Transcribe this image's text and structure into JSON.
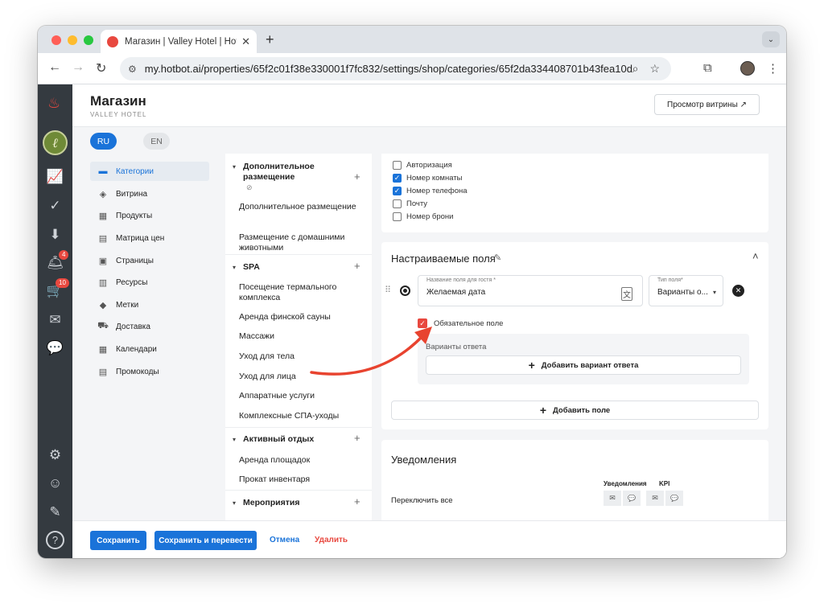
{
  "browser": {
    "tab_title": "Магазин | Valley Hotel | Hotbot",
    "tab_close": "✕",
    "new_tab": "+",
    "tab_menu": "⌄",
    "url": "my.hotbot.ai/properties/65f2c01f38e330001f7fc832/settings/shop/categories/65f2da334408701b43fea10d",
    "icons": {
      "back": "←",
      "forward": "→",
      "reload": "↻",
      "site_info": "⚙",
      "zoom": "⌕",
      "star": "☆",
      "extensions": "⧉",
      "menu": "⋮"
    }
  },
  "rail": {
    "logo": "♨",
    "avatar_initial": "ℓ",
    "icons": [
      "📈",
      "✓",
      "⬇",
      "🛎",
      "🛒",
      "✉",
      "💬"
    ],
    "badge_room_service": "4",
    "badge_cart": "10",
    "bottom_icons": [
      "⚙",
      "☺",
      "✎",
      "?"
    ]
  },
  "header": {
    "title": "Магазин",
    "subtitle": "VALLEY HOTEL",
    "preview_label": "Просмотр витрины ↗"
  },
  "languages": {
    "ru": "RU",
    "en": "EN"
  },
  "sidebar": {
    "items": [
      {
        "label": "Категории",
        "icon": "▬",
        "active": true
      },
      {
        "label": "Витрина",
        "icon": "◈",
        "active": false
      },
      {
        "label": "Продукты",
        "icon": "▦",
        "active": false
      },
      {
        "label": "Матрица цен",
        "icon": "▤",
        "active": false
      },
      {
        "label": "Страницы",
        "icon": "▣",
        "active": false
      },
      {
        "label": "Ресурсы",
        "icon": "▥",
        "active": false
      },
      {
        "label": "Метки",
        "icon": "◆",
        "active": false
      },
      {
        "label": "Доставка",
        "icon": "⛟",
        "active": false
      },
      {
        "label": "Календари",
        "icon": "▦",
        "active": false
      },
      {
        "label": "Промокоды",
        "icon": "▤",
        "active": false
      }
    ]
  },
  "categories": {
    "caret": "▾",
    "plus": "+",
    "hidden_icon": "⊘",
    "groups": [
      {
        "name": "Дополнительное размещение",
        "items": [
          "Дополнительное размещение",
          "Размещение с домашними животными"
        ]
      },
      {
        "name": "SPA",
        "items": [
          "Посещение термального комплекса",
          "Аренда финской сауны",
          "Массажи",
          "Уход для тела",
          "Уход для лица",
          "Аппаратные услуги",
          "Комплексные СПА-уходы"
        ]
      },
      {
        "name": "Активный отдых",
        "items": [
          "Аренда площадок",
          "Прокат инвентаря"
        ]
      },
      {
        "name": "Мероприятия",
        "items": []
      }
    ]
  },
  "contact_fields": {
    "items": [
      {
        "label": "Авторизация",
        "checked": false
      },
      {
        "label": "Номер комнаты",
        "checked": true
      },
      {
        "label": "Номер телефона",
        "checked": true
      },
      {
        "label": "Почту",
        "checked": false
      },
      {
        "label": "Номер брони",
        "checked": false
      }
    ],
    "check_mark": "✓"
  },
  "custom_fields": {
    "title": "Настраиваемые поля",
    "edit_icon": "✎",
    "collapse_icon": "˄",
    "drag_icon": "⠿",
    "name_label": "Название поля для гостя *",
    "name_value": "Желаемая дата",
    "translate_icon": "文",
    "type_label": "Тип поля*",
    "type_value": "Варианты о...",
    "type_caret": "▾",
    "remove_icon": "✕",
    "required_label": "Обязательное поле",
    "required_checked": true,
    "options_label": "Варианты ответа",
    "add_option_label": "Добавить вариант ответа",
    "add_field_label": "Добавить поле"
  },
  "notifications": {
    "title": "Уведомления",
    "col_notifications": "Уведомления",
    "col_kpi": "KPI",
    "toggle_all_label": "Переключить все",
    "mail_icon": "✉",
    "chat_icon": "💬"
  },
  "footer": {
    "save": "Сохранить",
    "save_translate": "Сохранить и перевести",
    "cancel": "Отмена",
    "delete": "Удалить"
  },
  "colors": {
    "accent": "#1a73d9",
    "danger": "#e8483f",
    "rail": "#343a40",
    "annotation_arrow": "#e8432f"
  }
}
